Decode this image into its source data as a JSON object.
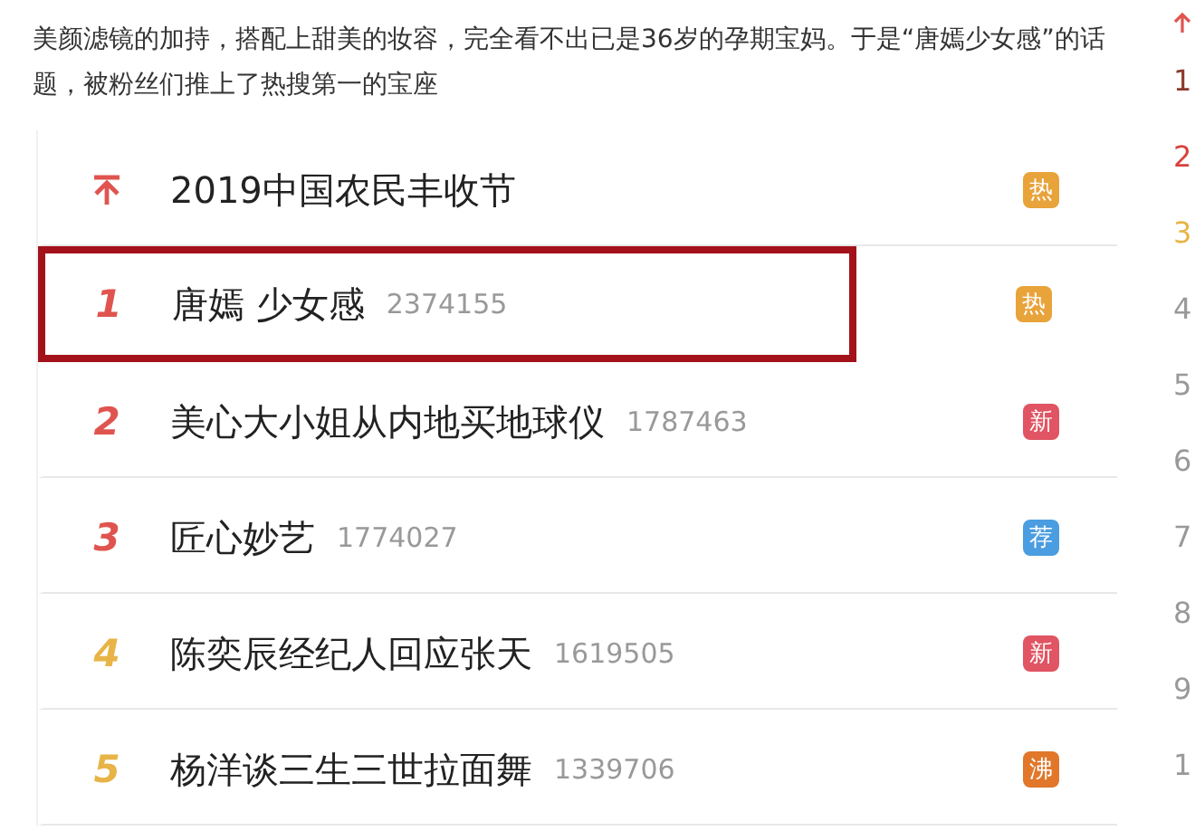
{
  "article": {
    "paragraph": "美颜滤镜的加持，搭配上甜美的妆容，完全看不出已是36岁的孕期宝妈。于是“唐嫣少女感”的话题，被粉丝们推上了热搜第一的宝座"
  },
  "hot_search": [
    {
      "kind": "pinned",
      "title": "2019中国农民丰收节",
      "badge": {
        "label": "热",
        "color": "#e8a33a"
      },
      "color": "#e0544f",
      "highlighted": false
    },
    {
      "kind": "ranked",
      "rank": "1",
      "title": "唐嫣 少女感",
      "count": "2374155",
      "badge": {
        "label": "热",
        "color": "#e8a33a"
      },
      "color": "#e0544f",
      "highlighted": true
    },
    {
      "kind": "ranked",
      "rank": "2",
      "title": "美心大小姐从内地买地球仪",
      "count": "1787463",
      "badge": {
        "label": "新",
        "color": "#e05463"
      },
      "color": "#e0544f",
      "highlighted": false
    },
    {
      "kind": "ranked",
      "rank": "3",
      "title": "匠心妙艺",
      "count": "1774027",
      "badge": {
        "label": "荐",
        "color": "#4a9de0"
      },
      "color": "#e0544f",
      "highlighted": false
    },
    {
      "kind": "ranked",
      "rank": "4",
      "title": "陈奕辰经纪人回应张天",
      "count": "1619505",
      "badge": {
        "label": "新",
        "color": "#e05463"
      },
      "color": "#e8b447",
      "highlighted": false
    },
    {
      "kind": "ranked",
      "rank": "5",
      "title": "杨洋谈三生三世拉面舞",
      "count": "1339706",
      "badge": {
        "label": "沸",
        "color": "#e0772a"
      },
      "color": "#e8b447",
      "highlighted": false
    }
  ],
  "side_ranking": [
    {
      "kind": "pinned",
      "color": "#e0544f"
    },
    {
      "kind": "ranked",
      "rank": "1",
      "color": "#8a3a2a"
    },
    {
      "kind": "ranked",
      "rank": "2",
      "color": "#d9423c"
    },
    {
      "kind": "ranked",
      "rank": "3",
      "color": "#e8b447"
    },
    {
      "kind": "ranked",
      "rank": "4",
      "color": "#999999"
    },
    {
      "kind": "ranked",
      "rank": "5",
      "color": "#999999"
    },
    {
      "kind": "ranked",
      "rank": "6",
      "color": "#999999"
    },
    {
      "kind": "ranked",
      "rank": "7",
      "color": "#999999"
    },
    {
      "kind": "ranked",
      "rank": "8",
      "color": "#999999"
    },
    {
      "kind": "ranked",
      "rank": "9",
      "color": "#999999"
    },
    {
      "kind": "ranked",
      "rank": "1",
      "color": "#999999"
    }
  ]
}
